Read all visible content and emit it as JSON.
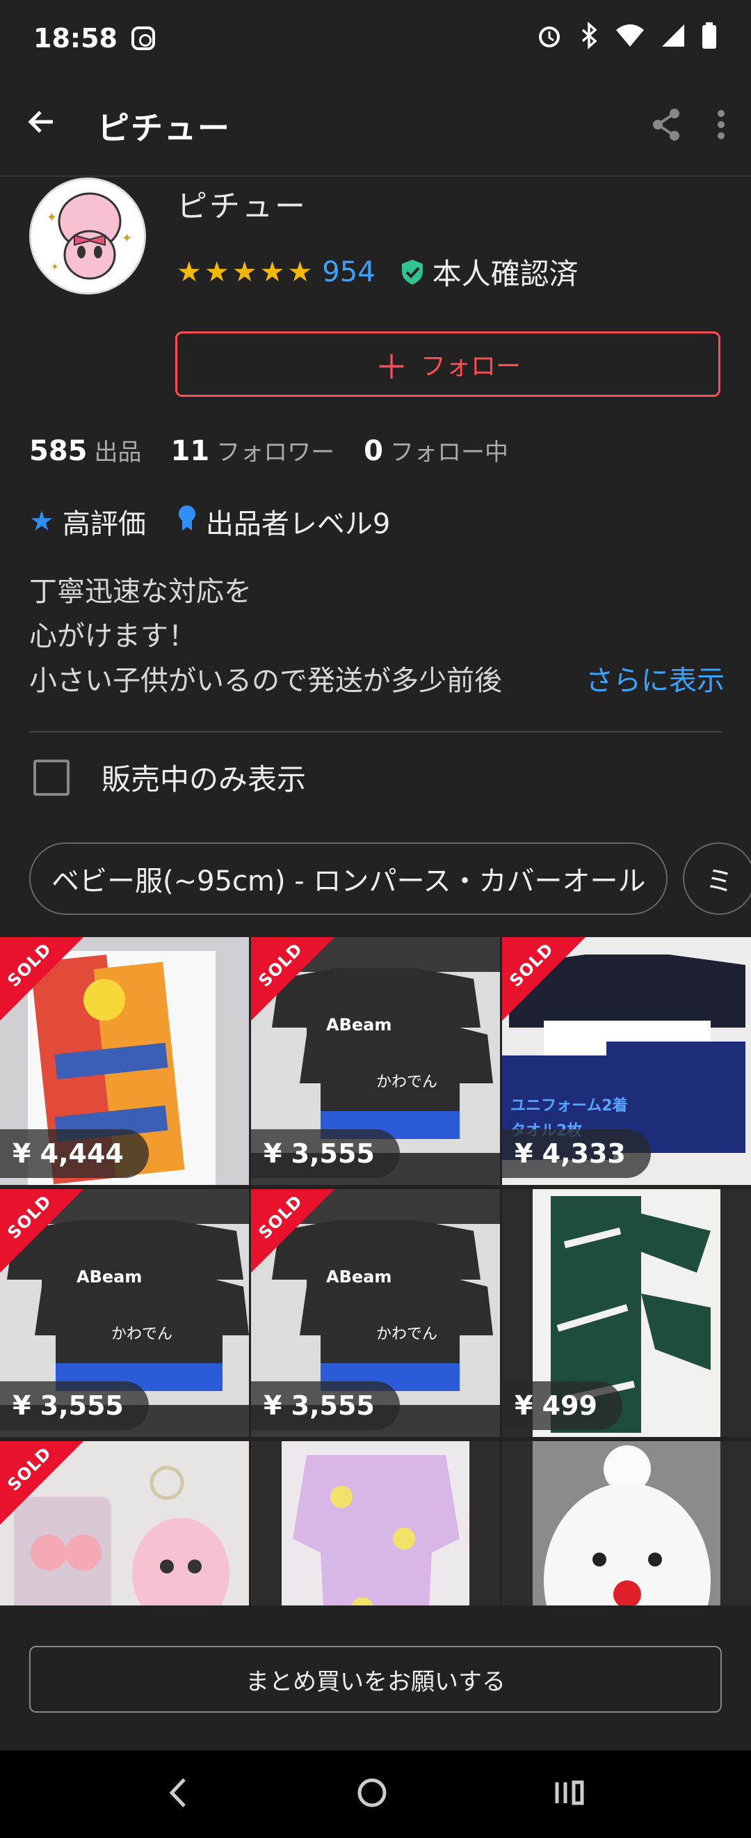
{
  "status_bar": {
    "time": "18:58"
  },
  "app_bar": {
    "title": "ピチュー"
  },
  "profile": {
    "name": "ピチュー",
    "stars": "★★★★★",
    "rating_count": "954",
    "verified_label": "本人確認済",
    "follow_label": "フォロー",
    "counts": [
      {
        "num": "585",
        "label": "出品"
      },
      {
        "num": "11",
        "label": "フォロワー"
      },
      {
        "num": "0",
        "label": "フォロー中"
      }
    ],
    "badges": {
      "high_rating": "高評価",
      "seller_level": "出品者レベル9"
    },
    "bio_lines": [
      "丁寧迅速な対応を",
      "心がけます！",
      "小さい子供がいるので発送が多少前後"
    ],
    "more_label": "さらに表示"
  },
  "filter": {
    "label": "販売中のみ表示"
  },
  "chips": [
    "ベビー服(~95cm) - ロンパース・カバーオール",
    "ミ"
  ],
  "items": [
    {
      "sold": true,
      "price": "¥ 4,444",
      "icon": "pokemon-card-packs"
    },
    {
      "sold": true,
      "price": "¥ 3,555",
      "icon": "soccer-jerseys"
    },
    {
      "sold": true,
      "price": "¥ 4,333",
      "icon": "uniform-towel-set"
    },
    {
      "sold": true,
      "price": "¥ 3,555",
      "icon": "soccer-jerseys"
    },
    {
      "sold": true,
      "price": "¥ 3,555",
      "icon": "soccer-jerseys"
    },
    {
      "sold": false,
      "price": "¥ 499",
      "icon": "towel"
    },
    {
      "sold": true,
      "price": "",
      "icon": "plush-toys"
    },
    {
      "sold": false,
      "price": "",
      "icon": "yukata"
    },
    {
      "sold": false,
      "price": "",
      "icon": "snowman-hat"
    }
  ],
  "sold_label": "SOLD",
  "overlay_texts": {
    "uniform": "ユニフォーム2着",
    "towel": "タオル2枚",
    "abeam": "ABeam",
    "kawaden": "かわでん"
  },
  "bottom": {
    "bulk_label": "まとめ買いをお願いする"
  },
  "colors": {
    "accent_red": "#ff4d55",
    "link_blue": "#3aa3ff",
    "star_gold": "#f5b800",
    "sold_red": "#e8122c"
  }
}
